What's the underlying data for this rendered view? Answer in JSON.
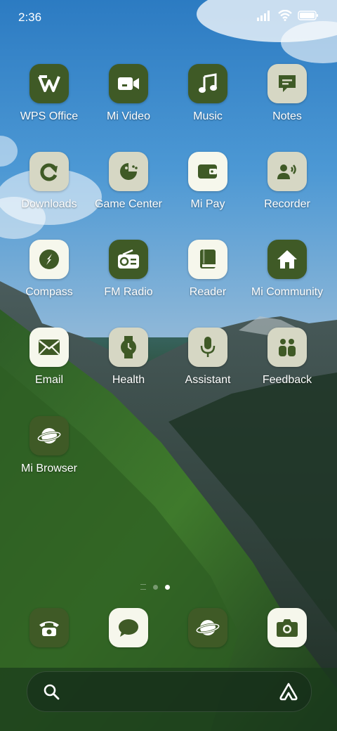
{
  "status": {
    "time": "2:36"
  },
  "colors": {
    "dark_tile": "#3f5a26",
    "light_tile": "#d6d7c4",
    "white_tile": "#f6f7ec",
    "glyph_dark": "#3f5a26",
    "glyph_light": "#ffffff"
  },
  "apps": [
    {
      "label": "WPS Office",
      "icon": "wps-office-icon"
    },
    {
      "label": "Mi Video",
      "icon": "mi-video-icon"
    },
    {
      "label": "Music",
      "icon": "music-icon"
    },
    {
      "label": "Notes",
      "icon": "notes-icon"
    },
    {
      "label": "Downloads",
      "icon": "downloads-icon"
    },
    {
      "label": "Game Center",
      "icon": "game-center-icon"
    },
    {
      "label": "Mi Pay",
      "icon": "wallet-icon"
    },
    {
      "label": "Recorder",
      "icon": "recorder-icon"
    },
    {
      "label": "Compass",
      "icon": "compass-icon"
    },
    {
      "label": "FM Radio",
      "icon": "radio-icon"
    },
    {
      "label": "Reader",
      "icon": "book-icon"
    },
    {
      "label": "Mi Community",
      "icon": "home-icon"
    },
    {
      "label": "Email",
      "icon": "email-icon"
    },
    {
      "label": "Health",
      "icon": "watch-icon"
    },
    {
      "label": "Assistant",
      "icon": "microphone-icon"
    },
    {
      "label": "Feedback",
      "icon": "feedback-icon"
    },
    {
      "label": "Mi Browser",
      "icon": "planet-icon"
    }
  ],
  "dock": [
    {
      "icon": "phone-icon"
    },
    {
      "icon": "message-icon"
    },
    {
      "icon": "browser-icon"
    },
    {
      "icon": "camera-icon"
    }
  ],
  "pages": {
    "count": 3,
    "active": 3
  },
  "search": {
    "left_icon": "search-icon",
    "right_icon": "assistant-logo-icon"
  }
}
